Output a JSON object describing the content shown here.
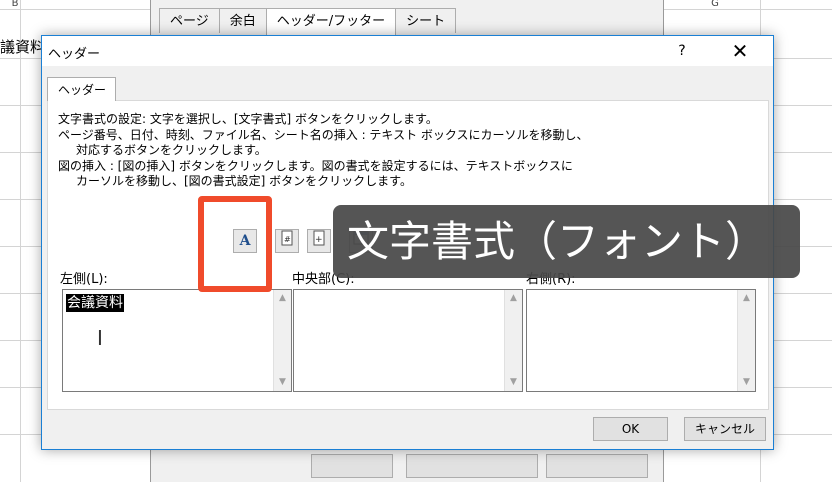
{
  "background_sheet": {
    "column_header_left": "B",
    "column_header_right": "G",
    "cell_text": "議資料"
  },
  "page_setup": {
    "tabs": [
      "ページ",
      "余白",
      "ヘッダー/フッター",
      "シート"
    ],
    "active_tab_index": 2
  },
  "dialog": {
    "title": "ヘッダー",
    "help_label": "?",
    "close_label": "✕",
    "tab_label": "ヘッダー",
    "instructions": {
      "line1": "文字書式の設定: 文字を選択し、[文字書式] ボタンをクリックします。",
      "line2": "ページ番号、日付、時刻、ファイル名、シート名の挿入 : テキスト ボックスにカーソルを移動し、",
      "line3": "対応するボタンをクリックします。",
      "line4": "図の挿入 : [図の挿入] ボタンをクリックします。図の書式を設定するには、テキストボックスに",
      "line5": "カーソルを移動し、[図の書式設定] ボタンをクリックします。"
    },
    "toolbar": {
      "format_text_glyph": "A"
    },
    "sections": {
      "left_label": "左側(L):",
      "center_label": "中央部(C):",
      "right_label": "右側(R):",
      "left_value": "会議資料"
    },
    "ok_label": "OK",
    "cancel_label": "キャンセル"
  },
  "overlay_caption": "文字書式（フォント）",
  "colors": {
    "highlight": "#f04b2b",
    "caption_bg": "#484848",
    "dialog_border": "#1a7fd4"
  }
}
